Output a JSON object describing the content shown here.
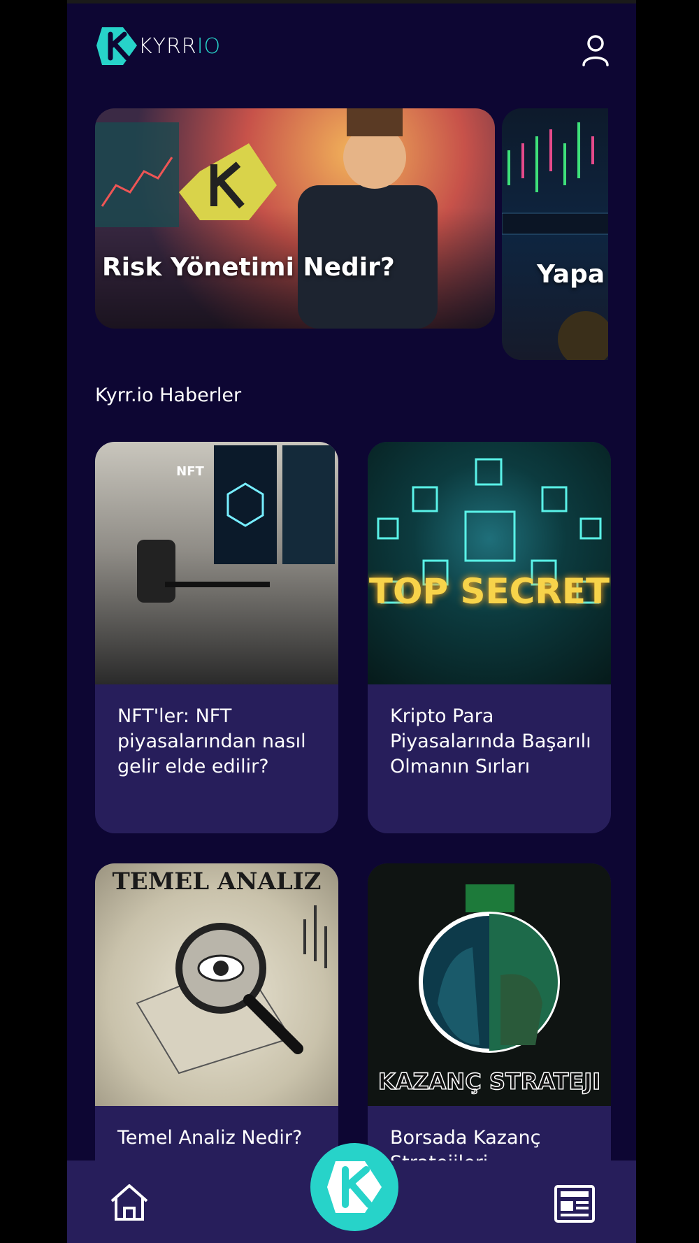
{
  "brand": {
    "name_prefix": "KYRR",
    "name_suffix": "IO"
  },
  "carousel": {
    "slides": [
      {
        "title": "Risk Yönetimi Nedir?"
      },
      {
        "title": "Yapa Piyasa"
      }
    ]
  },
  "section": {
    "title": "Kyrr.io Haberler"
  },
  "cards": [
    {
      "caption": "NFT'ler: NFT piyasalarından nasıl gelir elde edilir?",
      "image_label": "NFT"
    },
    {
      "caption": "Kripto Para Piyasalarında Başarılı Olmanın Sırları",
      "image_label": "TOP SECRET"
    },
    {
      "caption": "Temel Analiz Nedir?",
      "image_label": "TEMEL ANALIZ"
    },
    {
      "caption": "Borsada Kazanç Stratejileri",
      "image_label": "KAZANÇ STRATEJI"
    }
  ],
  "colors": {
    "background": "#0d0633",
    "card": "#271e5b",
    "accent": "#27d3c9"
  },
  "icons": {
    "user": "user-icon",
    "home": "home-icon",
    "news": "newspaper-icon",
    "logo": "kyrr-logo"
  }
}
